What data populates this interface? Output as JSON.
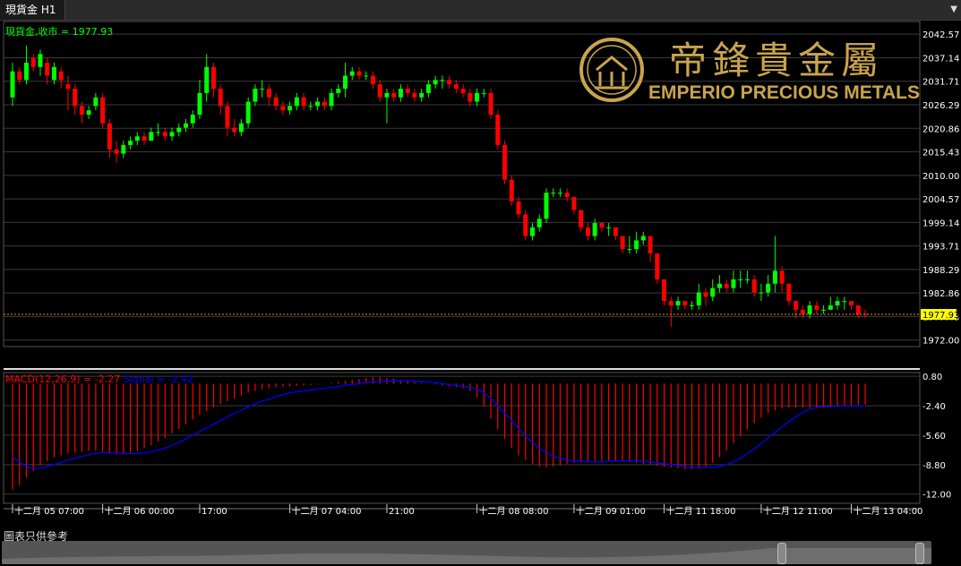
{
  "window": {
    "tab_title": "現貨金 H1"
  },
  "watermark": {
    "chinese": "帝鋒貴金屬",
    "english": "EMPERIO PRECIOUS METALS"
  },
  "footnote": "圖表只供參考",
  "colors": {
    "bull": "#00ff00",
    "bear": "#ff0000",
    "grid": "#3a3a3a",
    "axis_text": "#ffffff",
    "price_legend": "#00ff00",
    "macd": "#ff0000",
    "signal": "#0000ff",
    "last_price_line": "#d4a017",
    "watermark_gold": "#c9a44c"
  },
  "chart_data": [
    {
      "type": "candlestick",
      "symbol": "現貨金",
      "timeframe": "H1",
      "legend": "現貨金,收市 = 1977.93",
      "last_price": 1977.93,
      "last_price_label": "1977.93",
      "ylim": [
        1970.5,
        2045.5
      ],
      "y_ticks": [
        "2042.57",
        "2037.14",
        "2031.71",
        "2026.29",
        "2020.86",
        "2015.43",
        "2010.00",
        "2004.57",
        "1999.14",
        "1993.71",
        "1988.29",
        "1982.86",
        "1977.43",
        "1972.00"
      ],
      "x_ticks": [
        "十二月 05 07:00",
        "十二月 06 00:00",
        "17:00",
        "十二月 07 04:00",
        "21:00",
        "十二月 08 08:00",
        "十二月 09 01:00",
        "十二月 11 18:00",
        "十二月 12 11:00",
        "十二月 13 04:00"
      ],
      "closes": [
        2034,
        2032,
        2036,
        2035,
        2038,
        2033,
        2035,
        2032,
        2030,
        2026,
        2024,
        2025,
        2028,
        2022,
        2016,
        2015,
        2017,
        2018,
        2019,
        2018,
        2020,
        2020,
        2019,
        2020,
        2021,
        2022,
        2024,
        2029,
        2035,
        2030,
        2026,
        2021,
        2020,
        2022,
        2027,
        2030,
        2030,
        2028,
        2026,
        2025,
        2026,
        2028,
        2026,
        2026,
        2027,
        2026,
        2029,
        2030,
        2033,
        2034,
        2033,
        2033,
        2031,
        2028,
        2029,
        2028,
        2030,
        2029,
        2028,
        2029,
        2031,
        2032,
        2032,
        2031,
        2030,
        2029,
        2027,
        2029,
        2029,
        2024,
        2017,
        2009,
        2004,
        2001,
        1996,
        1998,
        2000,
        2006,
        2006,
        2006,
        2005,
        2002,
        1998,
        1996,
        1999,
        1998,
        1998,
        1996,
        1993,
        1993,
        1995,
        1996,
        1992,
        1986,
        1981,
        1980,
        1981,
        1980,
        1980,
        1983,
        1982,
        1984,
        1985,
        1984,
        1986,
        1986,
        1986,
        1983,
        1983,
        1985,
        1988,
        1985,
        1981,
        1979,
        1978,
        1980,
        1979,
        1979,
        1980,
        1981,
        1981,
        1980,
        1978,
        1977.93
      ],
      "opens": [
        2028,
        2034,
        2032,
        2037,
        2035,
        2036,
        2032,
        2034,
        2031,
        2030,
        2026,
        2024,
        2026,
        2028,
        2022,
        2016,
        2015,
        2017,
        2018,
        2019,
        2018,
        2020,
        2020,
        2019,
        2020,
        2021,
        2022,
        2024,
        2029,
        2035,
        2030,
        2026,
        2021,
        2020,
        2022,
        2027,
        2030,
        2030,
        2028,
        2026,
        2025,
        2026,
        2028,
        2026,
        2026,
        2027,
        2026,
        2029,
        2030,
        2033,
        2034,
        2033,
        2033,
        2031,
        2028,
        2029,
        2028,
        2030,
        2029,
        2028,
        2029,
        2031,
        2032,
        2032,
        2031,
        2030,
        2029,
        2027,
        2029,
        2029,
        2024,
        2017,
        2009,
        2004,
        2001,
        1996,
        1998,
        2000,
        2006,
        2006,
        2006,
        2005,
        2002,
        1998,
        1996,
        1999,
        1998,
        1998,
        1996,
        1993,
        1993,
        1995,
        1996,
        1992,
        1986,
        1981,
        1980,
        1981,
        1980,
        1980,
        1983,
        1982,
        1984,
        1985,
        1984,
        1986,
        1986,
        1986,
        1983,
        1983,
        1985,
        1988,
        1985,
        1981,
        1979,
        1978,
        1980,
        1979,
        1979,
        1980,
        1981,
        1981,
        1980,
        1978
      ],
      "highs": [
        2036,
        2035,
        2040,
        2038,
        2039,
        2037,
        2036,
        2035,
        2033,
        2031,
        2027,
        2026,
        2029,
        2029,
        2023,
        2018,
        2018,
        2019,
        2020,
        2020,
        2021,
        2022,
        2021,
        2021,
        2022,
        2023,
        2025,
        2032,
        2038,
        2036,
        2031,
        2027,
        2023,
        2023,
        2028,
        2031,
        2032,
        2031,
        2029,
        2027,
        2027,
        2029,
        2029,
        2027,
        2028,
        2028,
        2030,
        2031,
        2036,
        2035,
        2035,
        2034,
        2034,
        2032,
        2030,
        2030,
        2031,
        2031,
        2030,
        2030,
        2032,
        2033,
        2033,
        2033,
        2032,
        2031,
        2030,
        2030,
        2030,
        2030,
        2025,
        2018,
        2010,
        2005,
        2002,
        1999,
        2001,
        2007,
        2007,
        2007,
        2007,
        2003,
        1999,
        1999,
        2000,
        1999,
        1999,
        1998,
        1994,
        1996,
        1997,
        1997,
        1993,
        1987,
        1982,
        1982,
        1982,
        1981,
        1981,
        1985,
        1984,
        1986,
        1987,
        1986,
        1988,
        1988,
        1988,
        1987,
        1985,
        1987,
        1996,
        1989,
        1983,
        1981,
        1980,
        1981,
        1981,
        1980,
        1982,
        1982,
        1982,
        1981,
        1979,
        1979
      ],
      "lows": [
        2026,
        2031,
        2031,
        2034,
        2033,
        2031,
        2031,
        2030,
        2025,
        2024,
        2022,
        2023,
        2025,
        2021,
        2014,
        2013,
        2014,
        2016,
        2017,
        2017,
        2018,
        2019,
        2018,
        2018,
        2019,
        2020,
        2021,
        2023,
        2027,
        2028,
        2024,
        2019,
        2019,
        2019,
        2021,
        2026,
        2028,
        2026,
        2025,
        2024,
        2024,
        2025,
        2025,
        2025,
        2025,
        2025,
        2025,
        2028,
        2028,
        2032,
        2032,
        2032,
        2030,
        2027,
        2022,
        2027,
        2027,
        2028,
        2027,
        2027,
        2028,
        2030,
        2030,
        2030,
        2029,
        2028,
        2026,
        2026,
        2028,
        2023,
        2016,
        2008,
        2003,
        2000,
        1995,
        1995,
        1997,
        1999,
        2005,
        2005,
        2004,
        2001,
        1997,
        1995,
        1995,
        1997,
        1996,
        1995,
        1992,
        1992,
        1992,
        1994,
        1990,
        1985,
        1980,
        1975,
        1979,
        1979,
        1979,
        1979,
        1980,
        1981,
        1983,
        1983,
        1983,
        1984,
        1985,
        1982,
        1981,
        1982,
        1983,
        1983,
        1980,
        1977,
        1977,
        1977,
        1978,
        1978,
        1979,
        1979,
        1979,
        1979,
        1977,
        1977
      ]
    },
    {
      "type": "histogram-line",
      "legend_macd": "MACD(12,26,9) = -2.27",
      "legend_signal": "Signal = -2.42",
      "ylim": [
        -13.0,
        1.2
      ],
      "y_ticks": [
        "0.80",
        "-2.40",
        "-5.60",
        "-8.80",
        "-12.00"
      ],
      "macd": [
        -11.5,
        -11.0,
        -10.2,
        -9.5,
        -8.9,
        -8.4,
        -8.0,
        -7.8,
        -7.6,
        -7.5,
        -7.4,
        -7.3,
        -7.3,
        -7.4,
        -7.6,
        -7.7,
        -7.6,
        -7.5,
        -7.3,
        -7.0,
        -6.7,
        -6.3,
        -5.9,
        -5.4,
        -4.9,
        -4.4,
        -3.9,
        -3.4,
        -3.0,
        -2.6,
        -2.2,
        -1.9,
        -1.6,
        -1.3,
        -1.0,
        -0.8,
        -0.6,
        -0.5,
        -0.4,
        -0.35,
        -0.3,
        -0.25,
        -0.2,
        -0.15,
        -0.1,
        0.0,
        0.1,
        0.2,
        0.3,
        0.4,
        0.5,
        0.6,
        0.7,
        0.7,
        0.6,
        0.5,
        0.4,
        0.3,
        0.2,
        0.1,
        0.0,
        -0.1,
        -0.2,
        -0.3,
        -0.4,
        -0.5,
        -0.8,
        -1.5,
        -2.5,
        -3.8,
        -5.0,
        -6.0,
        -7.0,
        -7.8,
        -8.3,
        -8.7,
        -9.0,
        -9.1,
        -9.0,
        -8.9,
        -8.7,
        -8.6,
        -8.5,
        -8.5,
        -8.4,
        -8.4,
        -8.4,
        -8.5,
        -8.5,
        -8.5,
        -8.6,
        -8.7,
        -8.8,
        -8.9,
        -9.0,
        -9.1,
        -9.2,
        -9.3,
        -9.3,
        -9.2,
        -9.0,
        -8.6,
        -8.0,
        -7.3,
        -6.5,
        -5.7,
        -5.0,
        -4.3,
        -3.7,
        -3.2,
        -2.9,
        -2.7,
        -2.6,
        -2.6,
        -2.6,
        -2.6,
        -2.6,
        -2.6,
        -2.5,
        -2.5,
        -2.4,
        -2.4,
        -2.3,
        -2.27
      ],
      "signal": [
        -8.0,
        -8.5,
        -9.0,
        -9.2,
        -9.2,
        -9.0,
        -8.8,
        -8.6,
        -8.3,
        -8.1,
        -7.9,
        -7.7,
        -7.6,
        -7.5,
        -7.5,
        -7.5,
        -7.6,
        -7.6,
        -7.6,
        -7.5,
        -7.4,
        -7.2,
        -7.0,
        -6.7,
        -6.4,
        -6.0,
        -5.6,
        -5.2,
        -4.8,
        -4.4,
        -4.0,
        -3.6,
        -3.2,
        -2.9,
        -2.5,
        -2.2,
        -1.9,
        -1.7,
        -1.4,
        -1.2,
        -1.0,
        -0.9,
        -0.8,
        -0.7,
        -0.6,
        -0.5,
        -0.4,
        -0.3,
        -0.2,
        -0.1,
        0.0,
        0.1,
        0.2,
        0.25,
        0.3,
        0.3,
        0.3,
        0.3,
        0.3,
        0.2,
        0.2,
        0.1,
        0.0,
        -0.1,
        -0.2,
        -0.3,
        -0.4,
        -0.6,
        -1.0,
        -1.6,
        -2.4,
        -3.2,
        -4.0,
        -4.9,
        -5.7,
        -6.4,
        -7.0,
        -7.5,
        -7.9,
        -8.1,
        -8.3,
        -8.4,
        -8.4,
        -8.5,
        -8.5,
        -8.5,
        -8.4,
        -8.4,
        -8.4,
        -8.4,
        -8.4,
        -8.4,
        -8.5,
        -8.6,
        -8.7,
        -8.8,
        -8.9,
        -9.0,
        -9.1,
        -9.1,
        -9.1,
        -9.1,
        -9.0,
        -8.8,
        -8.5,
        -8.1,
        -7.6,
        -7.1,
        -6.5,
        -5.9,
        -5.3,
        -4.7,
        -4.1,
        -3.6,
        -3.1,
        -2.8,
        -2.6,
        -2.5,
        -2.5,
        -2.45,
        -2.45,
        -2.45,
        -2.45,
        -2.42
      ]
    }
  ]
}
